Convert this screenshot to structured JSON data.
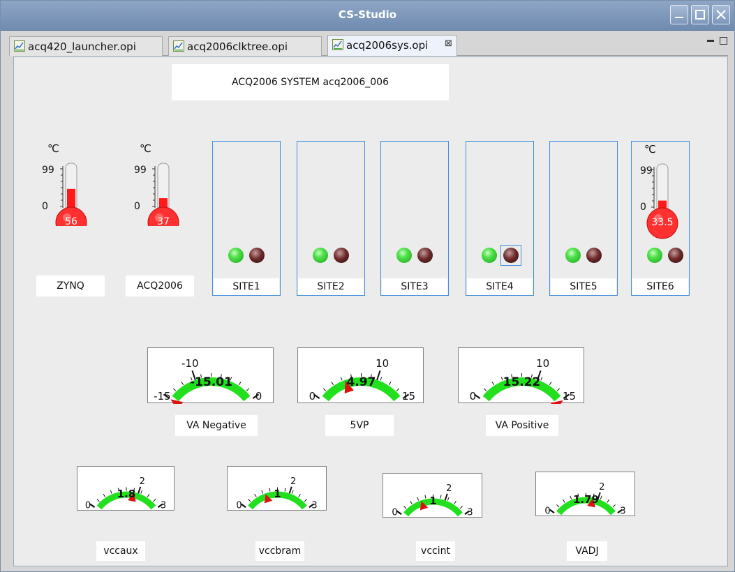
{
  "window": {
    "title": "CS-Studio"
  },
  "tabs": [
    {
      "label": "acq420_launcher.opi"
    },
    {
      "label": "acq2006clktree.opi"
    },
    {
      "label": "acq2006sys.opi"
    }
  ],
  "header": {
    "title": "ACQ2006 SYSTEM acq2006_006"
  },
  "thermometers": [
    {
      "unit": "℃",
      "max": "99",
      "min": "0",
      "value": "56",
      "label": "ZYNQ",
      "level": 0.56
    },
    {
      "unit": "℃",
      "max": "99",
      "min": "0",
      "value": "37",
      "label": "ACQ2006",
      "level": 0.37
    },
    {
      "unit": "℃",
      "max": "99",
      "min": "0",
      "value": "33.5",
      "label": "",
      "level": 0.335
    }
  ],
  "sites": [
    {
      "label": "SITE1"
    },
    {
      "label": "SITE2"
    },
    {
      "label": "SITE3"
    },
    {
      "label": "SITE4"
    },
    {
      "label": "SITE5"
    },
    {
      "label": "SITE6"
    }
  ],
  "meters_row1": [
    {
      "label": "VA Negative",
      "value": "-15.01",
      "min": "-15",
      "mid": "-10",
      "max": "0"
    },
    {
      "label": "5VP",
      "value": "4.97",
      "min": "0",
      "mid": "10",
      "max": "15"
    },
    {
      "label": "VA Positive",
      "value": "15.22",
      "min": "0",
      "mid": "10",
      "max": "15"
    }
  ],
  "meters_row2": [
    {
      "label": "vccaux",
      "value": "1.8",
      "min": "0",
      "mid": "2",
      "max": "3"
    },
    {
      "label": "vccbram",
      "value": "1",
      "min": "0",
      "mid": "2",
      "max": "3"
    },
    {
      "label": "vccint",
      "value": "1",
      "min": "0",
      "mid": "2",
      "max": "3"
    },
    {
      "label": "VADJ",
      "value": "1.79",
      "min": "0",
      "mid": "2",
      "max": "3"
    }
  ],
  "colors": {
    "accent": "#3f8ee0",
    "gauge_band": "#22e01e",
    "needle": "#e01010",
    "mercury": "#ff1a1a"
  }
}
